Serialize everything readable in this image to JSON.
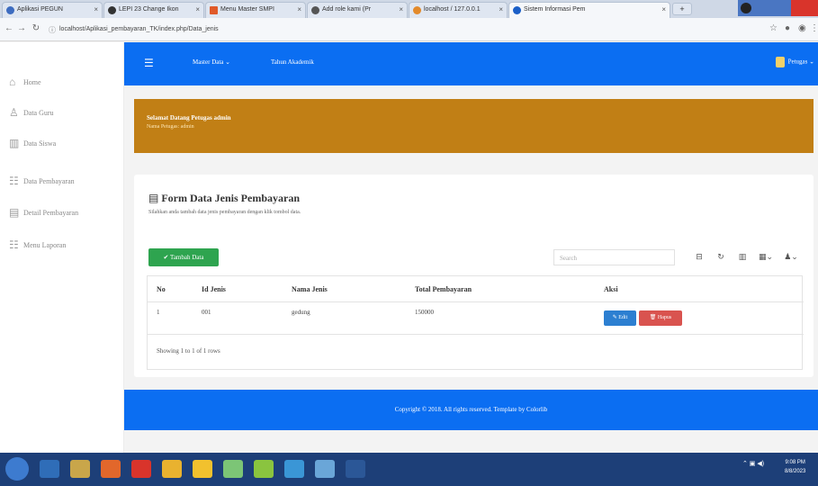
{
  "browser": {
    "tabs": [
      {
        "label": "Aplikasi PEGUN",
        "active": false
      },
      {
        "label": "LEPI 23 Change Ikon",
        "active": false
      },
      {
        "label": "Menu Master SMPI",
        "active": false
      },
      {
        "label": "Add role kami (Pr",
        "active": false
      },
      {
        "label": "localhost / 127.0.0.1",
        "active": false
      },
      {
        "label": "Sistem Informasi Pem",
        "active": true
      }
    ],
    "new_tab": "+",
    "url": "localhost/Aplikasi_pembayaran_TK/index.php/Data_jenis"
  },
  "sidebar": {
    "items": [
      {
        "label": "Home",
        "icon": "home-icon",
        "glyph": "⌂"
      },
      {
        "label": "Data Guru",
        "icon": "users-icon",
        "glyph": "♙"
      },
      {
        "label": "Data Siswa",
        "icon": "building-icon",
        "glyph": "▥"
      },
      {
        "label": "Data Pembayaran",
        "icon": "list-icon",
        "glyph": "☷"
      },
      {
        "label": "Detail Pembayaran",
        "icon": "detail-icon",
        "glyph": "▤"
      },
      {
        "label": "Menu Laporan",
        "icon": "report-icon",
        "glyph": "☷"
      }
    ]
  },
  "topnav": {
    "menu_icon": "☰",
    "master_data": "Master Data ⌄",
    "tahun": "Tahun Akademik",
    "user": "Petugas ⌄"
  },
  "banner": {
    "title": "Selamat Datang Petugas admin",
    "subtitle": "Nama Petugas: admin",
    "color": "#c17f15"
  },
  "card": {
    "title_icon": "▤",
    "title": "Form Data Jenis Pembayaran",
    "subtitle": "Silahkan anda tambah data jenis pembayaran dengan klik tombol data.",
    "add_button": "✔ Tambah Data",
    "search_placeholder": "Search",
    "toolbar": [
      "⊟",
      "↻",
      "▥",
      "▦⌄",
      "♟⌄"
    ]
  },
  "table": {
    "columns": [
      "No",
      "Id Jenis",
      "Nama Jenis",
      "Total Pembayaran",
      "Aksi"
    ],
    "rows": [
      {
        "no": "1",
        "id": "001",
        "nama": "gedung",
        "total": "150000"
      }
    ],
    "edit_label": "✎ Edit",
    "delete_label": "🗑 Hapus",
    "showing": "Showing 1 to 1 of 1 rows"
  },
  "footer": {
    "text": "Copyright © 2018. All rights reserved. Template by Colorlib"
  },
  "taskbar": {
    "tray": "⌃ ▣ ◀)",
    "time": "9:08 PM",
    "date": "8/8/2023"
  },
  "colors": {
    "primary": "#0b6ef2",
    "success": "#2ea44f",
    "danger": "#d9534f",
    "info": "#2c7fd1"
  }
}
